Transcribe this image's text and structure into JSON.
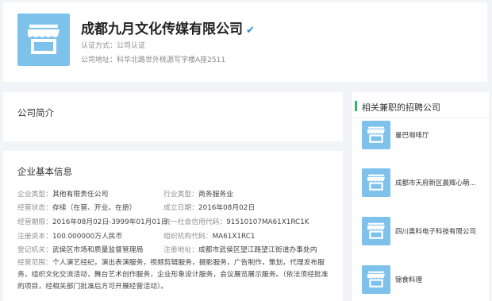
{
  "header": {
    "company_name": "成都九月文化传媒有限公司",
    "verified_icon": "verified-check-icon",
    "cert_label": "认证方式：",
    "cert_value": "公司认证",
    "address_label": "公司地址：",
    "address_value": "科华北路世外桃源写字楼A座2511"
  },
  "intro": {
    "title": "公司简介"
  },
  "info": {
    "title": "企业基本信息",
    "rows": [
      {
        "key": "企业类型：",
        "value": "其他有限责任公司"
      },
      {
        "key": "行业类型：",
        "value": "商务服务业"
      },
      {
        "key": "经营状态：",
        "value": "存续（在营、开业、在册）"
      },
      {
        "key": "成立日期：",
        "value": "2016年08月02日"
      },
      {
        "key": "经营期限：",
        "value": "2016年08月02日-3999年01月01日"
      },
      {
        "key": "统一社会信用代码：",
        "value": "91510107MA61X1RC1K"
      },
      {
        "key": "注册资本：",
        "value": "100.000000万人民币"
      },
      {
        "key": "组织机构代码：",
        "value": "MA61X1RC1"
      },
      {
        "key": "登记机关：",
        "value": "武侯区市场和质量监督管理局"
      },
      {
        "key": "注册地址：",
        "value": "成都市武侯区望江路望江街道办事处内"
      }
    ],
    "scope_label": "经营范围：",
    "scope_value": "个人演艺经纪，演出表演服务，视频剪辑服务，摄影服务，广告制作，策划，代理发布服务，组织文化交流活动，舞台艺术创作服务，企业形象设计服务，会议展览展示服务。（依法须经批准的项目，经相关部门批准后方可开展经营活动）。"
  },
  "sidebar": {
    "title": "相关兼职的招聘公司",
    "items": [
      {
        "name": "曼巴咖啡厅"
      },
      {
        "name": "成都市天府新区晨辉心萌..."
      },
      {
        "name": "四川奥科电子科技有限公司"
      },
      {
        "name": "锦食料理"
      }
    ]
  },
  "colors": {
    "accent_blue": "#2a8fd6",
    "logo_bg": "#7ec2ec",
    "sidebar_accent": "#3bb56c"
  }
}
